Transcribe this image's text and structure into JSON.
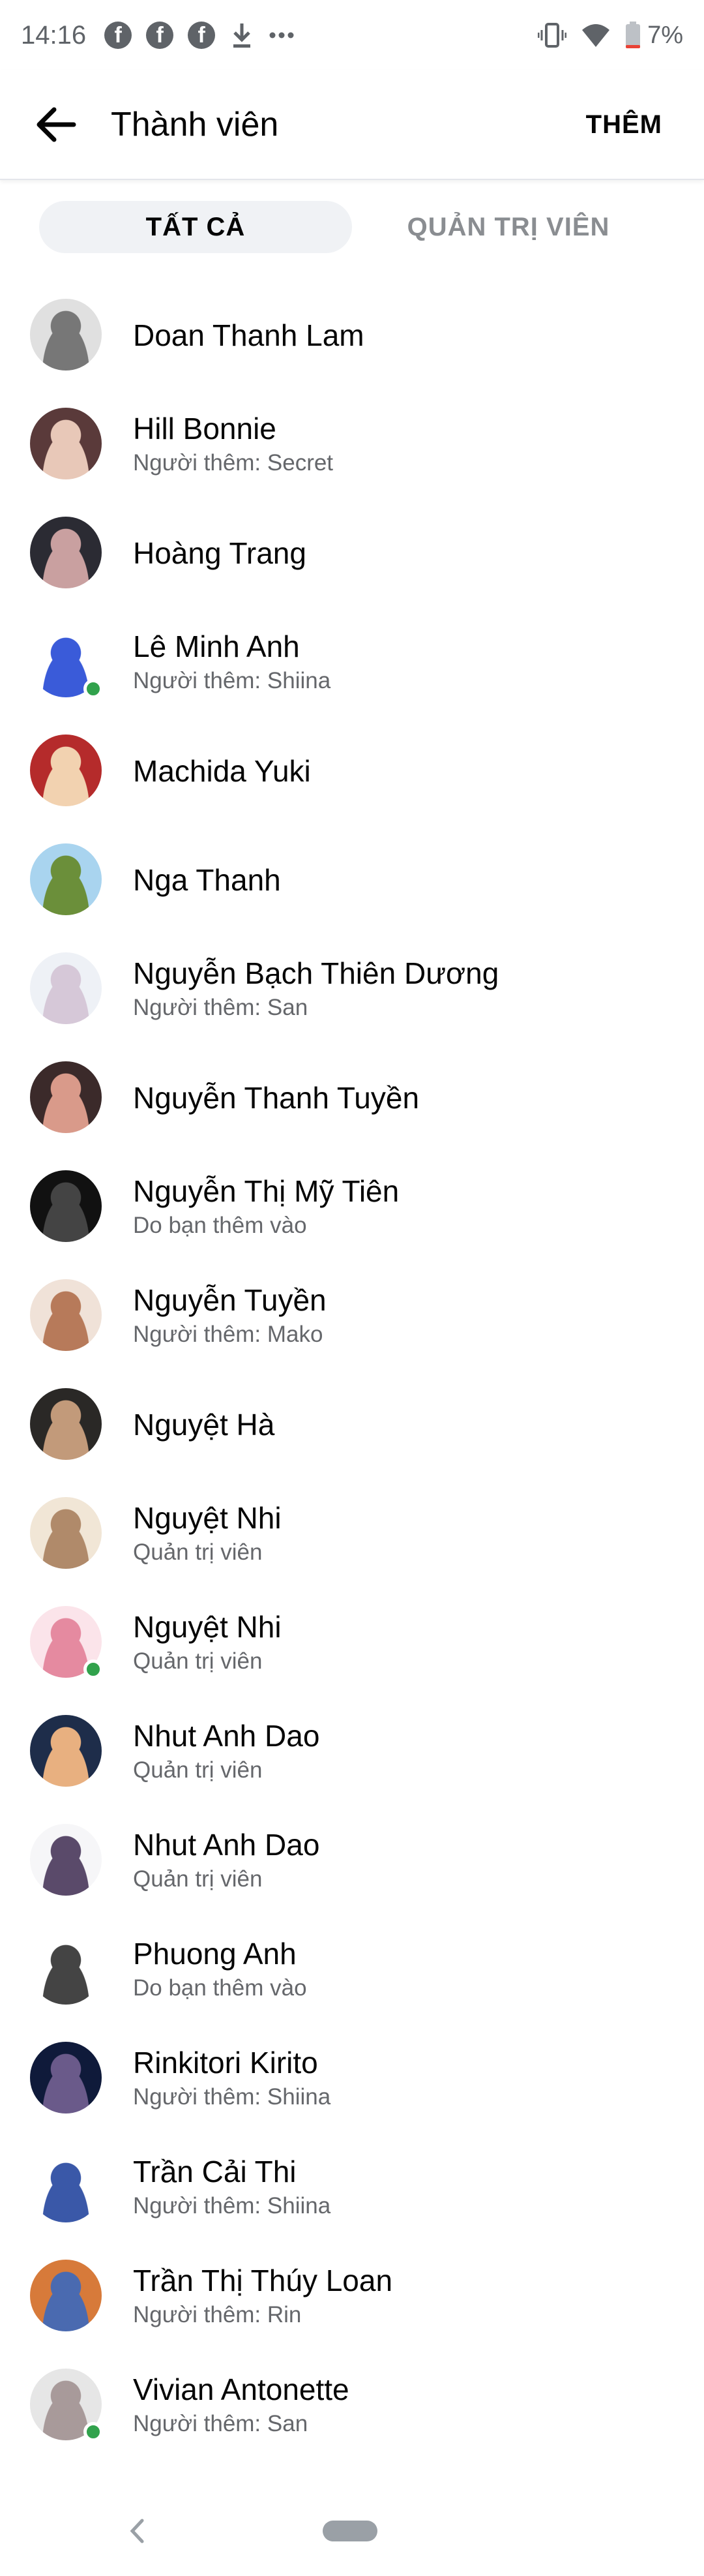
{
  "status_bar": {
    "time": "14:16",
    "left_icons": [
      "facebook-icon",
      "facebook-icon",
      "facebook-icon",
      "download-icon",
      "more-icon"
    ],
    "right_icons": [
      "vibrate-icon",
      "wifi-icon",
      "battery-icon"
    ],
    "battery": "7%"
  },
  "header": {
    "title": "Thành viên",
    "add_label": "THÊM"
  },
  "tabs": {
    "all": "TẤT CẢ",
    "admins": "QUẢN TRỊ VIÊN",
    "selected": "all"
  },
  "colors": {
    "online": "#31a24c",
    "secondary_text": "#65676b",
    "tab_selected_bg": "#f0f2f5"
  },
  "members": [
    {
      "name": "Doan Thanh Lam",
      "sub": "",
      "online": false
    },
    {
      "name": "Hill Bonnie",
      "sub": "Người thêm: Secret",
      "online": false
    },
    {
      "name": "Hoàng Trang",
      "sub": "",
      "online": false
    },
    {
      "name": "Lê Minh Anh",
      "sub": "Người thêm: Shiina",
      "online": true
    },
    {
      "name": "Machida Yuki",
      "sub": "",
      "online": false
    },
    {
      "name": "Nga Thanh",
      "sub": "",
      "online": false
    },
    {
      "name": "Nguyễn Bạch Thiên Dương",
      "sub": "Người thêm: San",
      "online": false
    },
    {
      "name": "Nguyễn Thanh Tuyền",
      "sub": "",
      "online": false
    },
    {
      "name": "Nguyễn Thị Mỹ Tiên",
      "sub": "Do bạn thêm vào",
      "online": false
    },
    {
      "name": "Nguyễn Tuyền",
      "sub": "Người thêm: Mako",
      "online": false
    },
    {
      "name": "Nguyệt Hà",
      "sub": "",
      "online": false
    },
    {
      "name": "Nguyệt Nhi",
      "sub": "Quản trị viên",
      "online": false
    },
    {
      "name": "Nguyệt Nhi",
      "sub": "Quản trị viên",
      "online": true
    },
    {
      "name": "Nhut Anh Dao",
      "sub": "Quản trị viên",
      "online": false
    },
    {
      "name": "Nhut Anh Dao",
      "sub": "Quản trị viên",
      "online": false
    },
    {
      "name": "Phuong Anh",
      "sub": "Do bạn thêm vào",
      "online": false
    },
    {
      "name": "Rinkitori Kirito",
      "sub": "Người thêm: Shiina",
      "online": false
    },
    {
      "name": "Trần Cải Thi",
      "sub": "Người thêm: Shiina",
      "online": false
    },
    {
      "name": "Trần Thị Thúy Loan",
      "sub": "Người thêm: Rin",
      "online": false
    },
    {
      "name": "Vivian Antonette",
      "sub": "Người thêm: San",
      "online": true
    }
  ],
  "nav_bar": {
    "icons": [
      "back-chevron-icon",
      "home-pill-icon"
    ]
  }
}
